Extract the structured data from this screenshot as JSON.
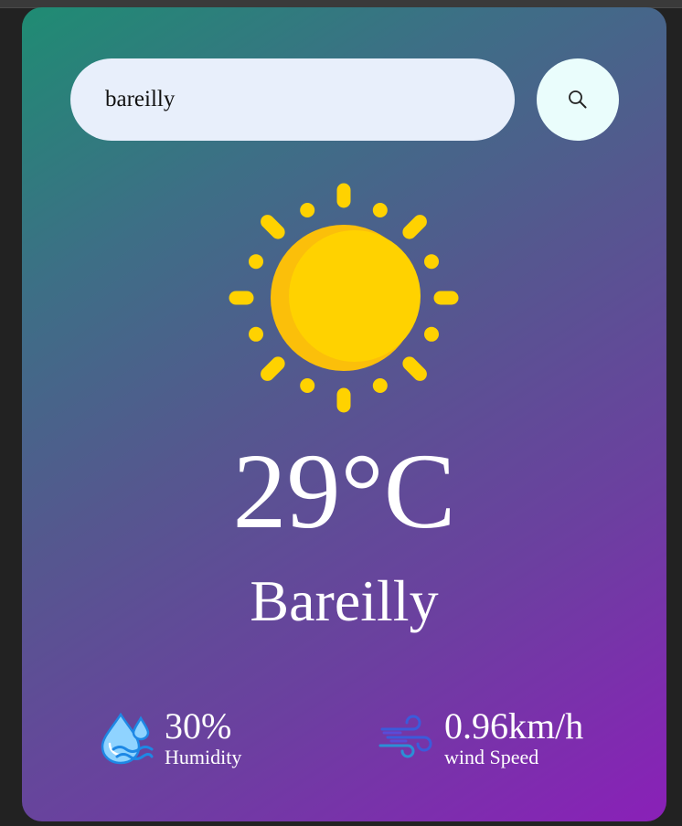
{
  "search": {
    "value": "bareilly",
    "icon": "search-icon"
  },
  "weather": {
    "icon": "sun-icon",
    "temperature": "29°C",
    "city": "Bareilly"
  },
  "details": {
    "humidity": {
      "value": "30%",
      "label": "Humidity",
      "icon": "humidity-icon"
    },
    "wind": {
      "value": "0.96km/h",
      "label": "wind Speed",
      "icon": "wind-icon"
    }
  },
  "colors": {
    "gradient_start": "#1f8c73",
    "gradient_end": "#8a20b8",
    "sun_yellow": "#ffd200",
    "search_bg": "#e8effb",
    "button_bg": "#eafdfc"
  }
}
